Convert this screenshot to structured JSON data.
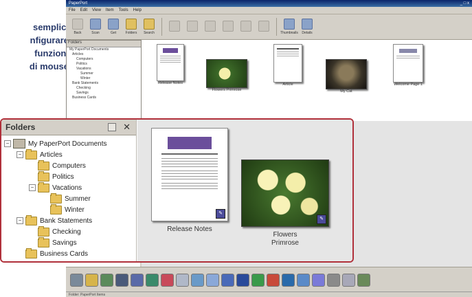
{
  "caption": {
    "lines": [
      "semplici",
      "nfigurare",
      "funzioni",
      "di mouse"
    ]
  },
  "window": {
    "title": "PaperPort",
    "controls": "_ □ x",
    "menu": [
      "File",
      "Edit",
      "View",
      "Item",
      "Tools",
      "Help"
    ]
  },
  "toolbar": {
    "buttons": [
      "Back",
      "Scan",
      "Get",
      "Folders",
      "Search",
      "Thumbnails",
      "Details"
    ]
  },
  "small_tree": {
    "header": "Folders",
    "lines": [
      "My PaperPort Documents",
      "Articles",
      "Computers",
      "Politics",
      "Vacations",
      "Summer",
      "Winter",
      "Bank Statements",
      "Checking",
      "Savings",
      "Business Cards"
    ]
  },
  "top_thumbs": [
    {
      "label": "Release Notes"
    },
    {
      "label": "Flowers Primrose"
    },
    {
      "label": "Article"
    },
    {
      "label": "My Cat"
    },
    {
      "label": "Welcome Page 1"
    }
  ],
  "folders_panel": {
    "title": "Folders",
    "pin_icon": "pin-icon",
    "close_icon": "close-icon",
    "tree": [
      {
        "label": "My PaperPort Documents",
        "level": 0,
        "expander": "−"
      },
      {
        "label": "Articles",
        "level": 1,
        "expander": "−"
      },
      {
        "label": "Computers",
        "level": 2,
        "expander": ""
      },
      {
        "label": "Politics",
        "level": 2,
        "expander": ""
      },
      {
        "label": "Vacations",
        "level": 2,
        "expander": "−"
      },
      {
        "label": "Summer",
        "level": 3,
        "expander": ""
      },
      {
        "label": "Winter",
        "level": 3,
        "expander": ""
      },
      {
        "label": "Bank Statements",
        "level": 1,
        "expander": "−"
      },
      {
        "label": "Checking",
        "level": 2,
        "expander": ""
      },
      {
        "label": "Savings",
        "level": 2,
        "expander": ""
      },
      {
        "label": "Business Cards",
        "level": 1,
        "expander": ""
      }
    ]
  },
  "big_thumbs": {
    "doc_label": "Release Notes",
    "photo_label_1": "Flowers",
    "photo_label_2": "Primrose"
  },
  "colors": {
    "callout_border": "#b0303a",
    "caption_text": "#2a3b6b",
    "purple_header": "#6b4e9b"
  },
  "statusbar": {
    "text": "Folder: PaperPort Items"
  }
}
